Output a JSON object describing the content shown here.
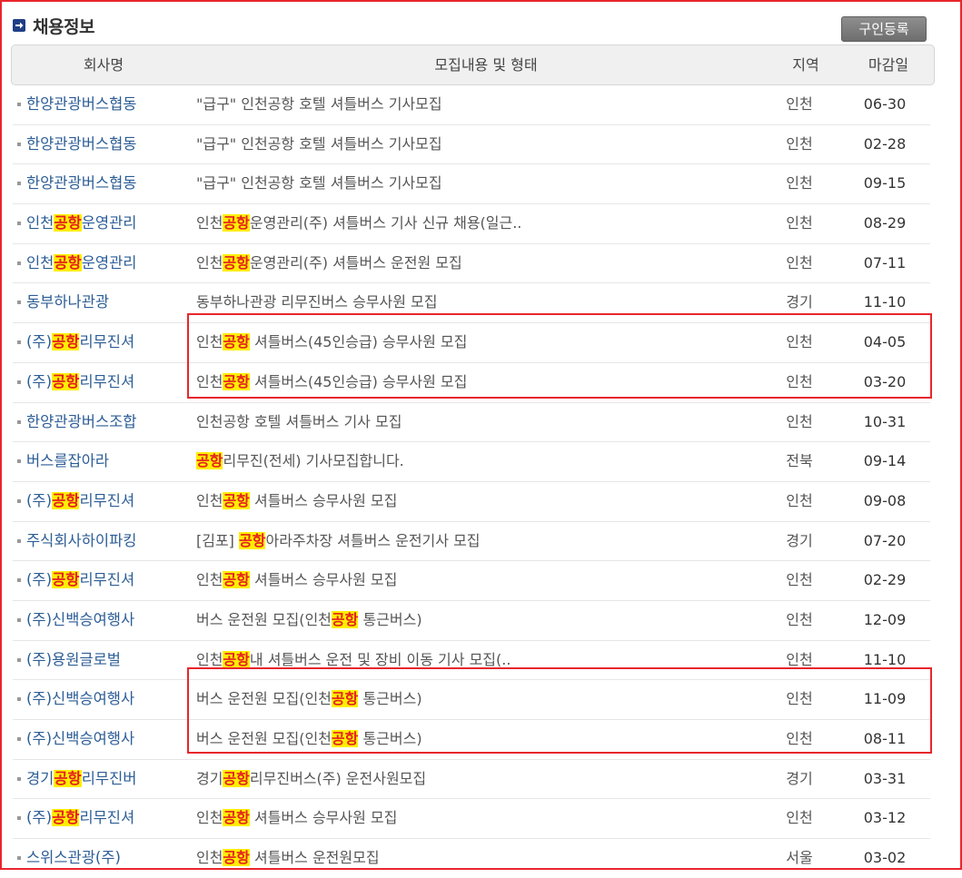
{
  "header": {
    "title": "채용정보",
    "register_button": "구인등록"
  },
  "columns": {
    "company": "회사명",
    "content": "모집내용 및 형태",
    "region": "지역",
    "deadline": "마감일"
  },
  "highlight_keyword": "공항",
  "rows": [
    {
      "company": "한양관광버스협동",
      "content": "\"급구\" 인천공항 호텔 셔틀버스 기사모집",
      "region": "인천",
      "deadline": "06-30"
    },
    {
      "company": "한양관광버스협동",
      "content": "\"급구\" 인천공항 호텔 셔틀버스 기사모집",
      "region": "인천",
      "deadline": "02-28"
    },
    {
      "company": "한양관광버스협동",
      "content": "\"급구\" 인천공항 호텔 셔틀버스 기사모집",
      "region": "인천",
      "deadline": "09-15"
    },
    {
      "company": "인천공항운영관리",
      "content": "인천공항운영관리(주) 셔틀버스 기사 신규 채용(일근..",
      "region": "인천",
      "deadline": "08-29"
    },
    {
      "company": "인천공항운영관리",
      "content": "인천공항운영관리(주) 셔틀버스 운전원 모집",
      "region": "인천",
      "deadline": "07-11"
    },
    {
      "company": "동부하나관광",
      "content": "동부하나관광 리무진버스 승무사원 모집",
      "region": "경기",
      "deadline": "11-10"
    },
    {
      "company": "(주)공항리무진셔",
      "content": "인천공항 셔틀버스(45인승급) 승무사원 모집",
      "region": "인천",
      "deadline": "04-05"
    },
    {
      "company": "(주)공항리무진셔",
      "content": "인천공항 셔틀버스(45인승급) 승무사원 모집",
      "region": "인천",
      "deadline": "03-20"
    },
    {
      "company": "한양관광버스조합",
      "content": "인천공항 호텔 셔틀버스 기사 모집",
      "region": "인천",
      "deadline": "10-31"
    },
    {
      "company": "버스를잡아라",
      "content": "공항리무진(전세) 기사모집합니다.",
      "region": "전북",
      "deadline": "09-14"
    },
    {
      "company": "(주)공항리무진셔",
      "content": "인천공항 셔틀버스 승무사원 모집",
      "region": "인천",
      "deadline": "09-08"
    },
    {
      "company": "주식회사하이파킹",
      "content": "[김포] 공항아라주차장 셔틀버스 운전기사 모집",
      "region": "경기",
      "deadline": "07-20"
    },
    {
      "company": "(주)공항리무진셔",
      "content": "인천공항 셔틀버스 승무사원 모집",
      "region": "인천",
      "deadline": "02-29"
    },
    {
      "company": "(주)신백승여행사",
      "content": "버스 운전원 모집(인천공항 통근버스)",
      "region": "인천",
      "deadline": "12-09"
    },
    {
      "company": "(주)용원글로벌",
      "content": "인천공항내 셔틀버스 운전 및 장비 이동 기사 모집(..",
      "region": "인천",
      "deadline": "11-10"
    },
    {
      "company": "(주)신백승여행사",
      "content": "버스 운전원 모집(인천공항 통근버스)",
      "region": "인천",
      "deadline": "11-09"
    },
    {
      "company": "(주)신백승여행사",
      "content": "버스 운전원 모집(인천공항 통근버스)",
      "region": "인천",
      "deadline": "08-11"
    },
    {
      "company": "경기공항리무진버",
      "content": "경기공항리무진버스(주) 운전사원모집",
      "region": "경기",
      "deadline": "03-31"
    },
    {
      "company": "(주)공항리무진셔",
      "content": "인천공항 셔틀버스 승무사원 모집",
      "region": "인천",
      "deadline": "03-12"
    },
    {
      "company": "스위스관광(주)",
      "content": "인천공항 셔틀버스 운전원모집",
      "region": "서울",
      "deadline": "03-02"
    }
  ],
  "highlighted": {
    "company": [
      false,
      false,
      false,
      true,
      true,
      false,
      true,
      true,
      false,
      false,
      true,
      false,
      true,
      false,
      false,
      false,
      false,
      true,
      true,
      false
    ],
    "content": [
      false,
      false,
      false,
      true,
      true,
      false,
      true,
      true,
      false,
      true,
      true,
      true,
      true,
      true,
      true,
      true,
      true,
      true,
      true,
      true
    ]
  }
}
